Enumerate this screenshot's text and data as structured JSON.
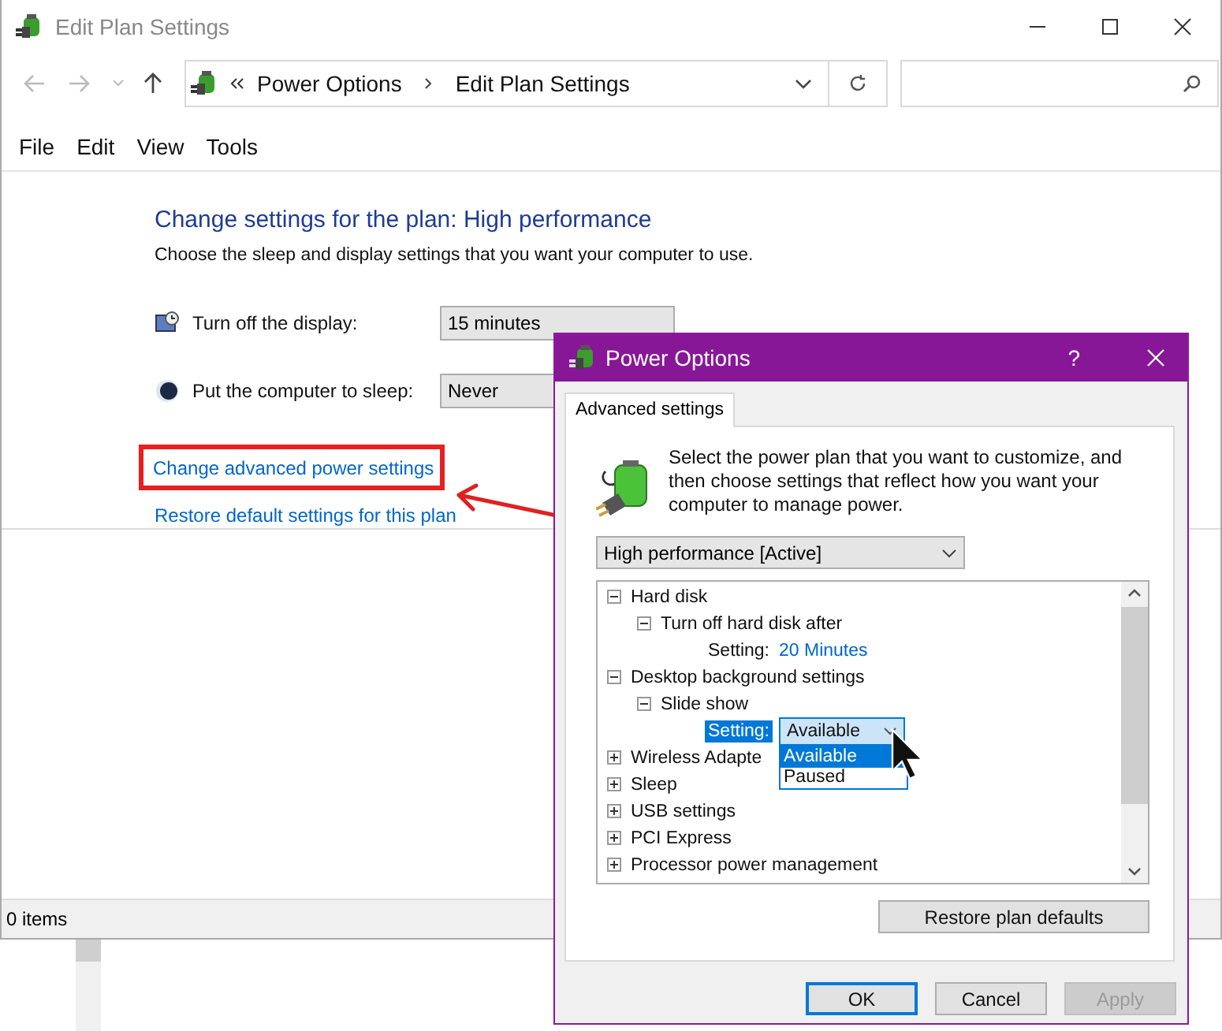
{
  "window": {
    "title": "Edit Plan Settings"
  },
  "address": {
    "breadcrumb": [
      "Power Options",
      "Edit Plan Settings"
    ]
  },
  "menu": [
    "File",
    "Edit",
    "View",
    "Tools"
  ],
  "content": {
    "heading": "Change settings for the plan: High performance",
    "subtitle": "Choose the sleep and display settings that you want your computer to use.",
    "settings": [
      {
        "kind": "display",
        "label": "Turn off the display:",
        "value": "15 minutes"
      },
      {
        "kind": "sleep",
        "label": "Put the computer to sleep:",
        "value": "Never"
      }
    ],
    "links": [
      {
        "label": "Change advanced power settings",
        "highlighted": true
      },
      {
        "label": "Restore default settings for this plan",
        "highlighted": false
      }
    ]
  },
  "status_bar": "0 items",
  "dialog": {
    "title": "Power Options",
    "help": "?",
    "tabs": [
      {
        "label": "Advanced settings",
        "selected": true
      }
    ],
    "description": "Select the power plan that you want to customize, and then choose settings that reflect how you want your computer to manage power.",
    "plan": "High performance [Active]",
    "tree": [
      {
        "kind": "group",
        "label": "Hard disk",
        "expanded": true,
        "children": [
          {
            "kind": "group",
            "label": "Turn off hard disk after",
            "expanded": true,
            "children": [
              {
                "kind": "setting",
                "label": "Setting:",
                "value": "20 Minutes",
                "selected": false
              }
            ]
          }
        ]
      },
      {
        "kind": "group",
        "label": "Desktop background settings",
        "expanded": true,
        "children": [
          {
            "kind": "group",
            "label": "Slide show",
            "expanded": true,
            "children": [
              {
                "kind": "setting",
                "label": "Setting:",
                "value": "Available",
                "selected": true,
                "options": [
                  {
                    "label": "Available",
                    "selected": true
                  },
                  {
                    "label": "Paused",
                    "selected": false
                  }
                ]
              }
            ]
          }
        ]
      },
      {
        "kind": "group",
        "label": "Wireless Adapte",
        "expanded": false
      },
      {
        "kind": "group",
        "label": "Sleep",
        "expanded": false
      },
      {
        "kind": "group",
        "label": "USB settings",
        "expanded": false
      },
      {
        "kind": "group",
        "label": "PCI Express",
        "expanded": false
      },
      {
        "kind": "group",
        "label": "Processor power management",
        "expanded": false
      }
    ],
    "restore_button": "Restore plan defaults",
    "buttons": [
      {
        "label": "OK",
        "kind": "default",
        "disabled": false
      },
      {
        "label": "Cancel",
        "kind": "normal",
        "disabled": false
      },
      {
        "label": "Apply",
        "kind": "normal",
        "disabled": true
      }
    ]
  }
}
